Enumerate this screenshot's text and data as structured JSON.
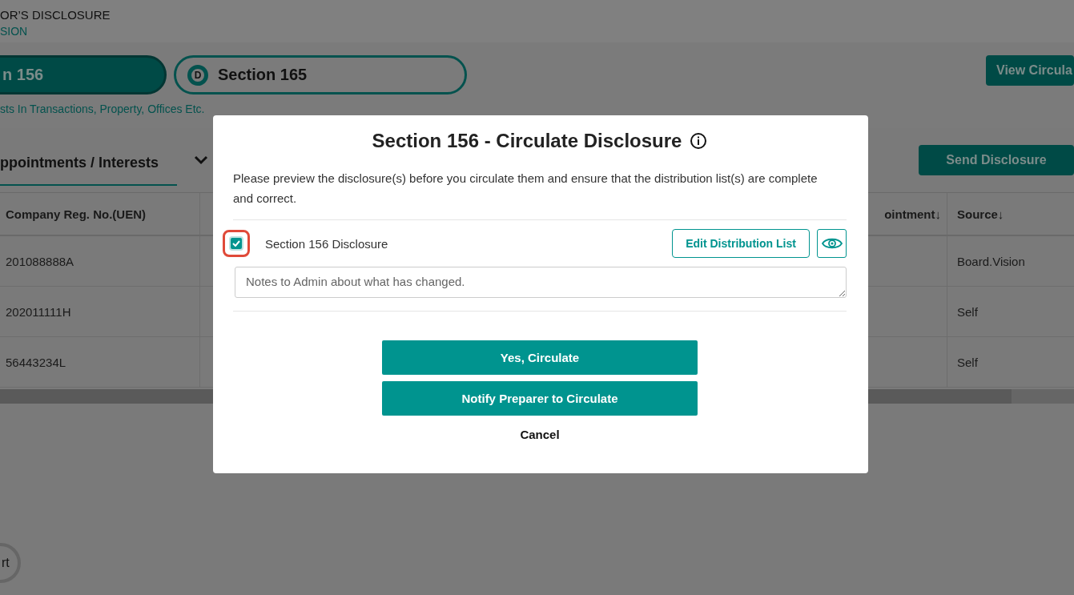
{
  "header": {
    "title": "OR’S DISCLOSURE",
    "subtitle": "SION"
  },
  "sections": [
    {
      "label": "n 156",
      "selected": true
    },
    {
      "label": "Section 165",
      "badge": "D",
      "selected": false
    }
  ],
  "section_caption": "sts In Transactions, Property, Offices Etc.",
  "view_button": "View Circula",
  "tab": {
    "label": "ppointments / Interests"
  },
  "send_button": "Send Disclosure",
  "table": {
    "columns": [
      "Company Reg. No.(UEN)",
      "ointment↓",
      "Source↓"
    ],
    "rows": [
      {
        "uen": "201088888A",
        "source": "Board.Vision"
      },
      {
        "uen": "202011111H",
        "source": "Self"
      },
      {
        "uen": "56443234L",
        "source": "Self"
      }
    ]
  },
  "corner_button": "rt",
  "dialog": {
    "title": "Section 156 - Circulate Disclosure",
    "message": "Please preview the disclosure(s) before you circulate them and ensure that the distribution list(s) are complete and correct.",
    "items": [
      {
        "label": "Section 156 Disclosure",
        "checked": true,
        "edit_button": "Edit Distribution List",
        "notes_placeholder": "Notes to Admin about what has changed."
      }
    ],
    "buttons": [
      "Yes, Circulate",
      "Notify Preparer to Circulate"
    ],
    "cancel": "Cancel"
  }
}
